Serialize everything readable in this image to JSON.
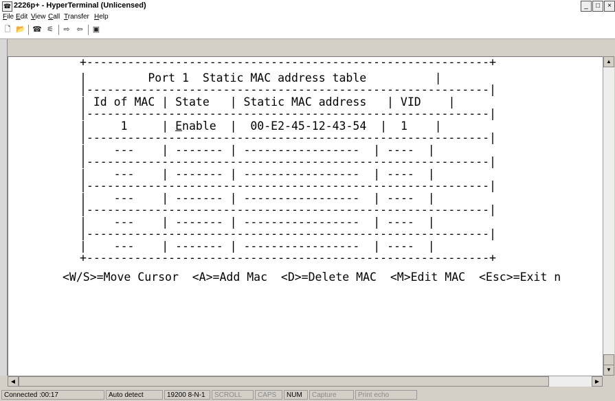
{
  "window": {
    "title": "2226p+ - HyperTerminal (Unlicensed)"
  },
  "menu": [
    {
      "mnemonic": "F",
      "rest": "ile"
    },
    {
      "mnemonic": "E",
      "rest": "dit"
    },
    {
      "mnemonic": "V",
      "rest": "iew"
    },
    {
      "mnemonic": "C",
      "rest": "all"
    },
    {
      "mnemonic": "T",
      "rest": "ransfer"
    },
    {
      "mnemonic": "H",
      "rest": "elp"
    }
  ],
  "toolbar": {
    "new_icon": "new-connection-icon",
    "open_icon": "open-folder-icon",
    "call_icon": "call-icon",
    "disconnect_icon": "disconnect-icon",
    "send_icon": "send-file-icon",
    "receive_icon": "receive-file-icon",
    "properties_icon": "properties-icon"
  },
  "terminal": {
    "table_title": "Port 1  Static MAC address table",
    "headers": [
      "Id of MAC",
      "State",
      "Static MAC address",
      "VID"
    ],
    "rows": [
      {
        "id": "1",
        "state_first": "E",
        "state_rest": "nable",
        "mac": "00-E2-45-12-43-54",
        "vid": "1"
      },
      {
        "id": "---",
        "state": "-------",
        "mac": "-----------------",
        "vid": "----"
      },
      {
        "id": "---",
        "state": "-------",
        "mac": "-----------------",
        "vid": "----"
      },
      {
        "id": "---",
        "state": "-------",
        "mac": "-----------------",
        "vid": "----"
      },
      {
        "id": "---",
        "state": "-------",
        "mac": "-----------------",
        "vid": "----"
      },
      {
        "id": "---",
        "state": "-------",
        "mac": "-----------------",
        "vid": "----"
      }
    ],
    "help_line": "<W/S>=Move Cursor  <A>=Add Mac  <D>=Delete MAC  <M>Edit MAC  <Esc>=Exit n"
  },
  "statusbar": {
    "connected": "Connected :00:17",
    "detect": "Auto detect",
    "settings": "19200 8-N-1",
    "scroll": "SCROLL",
    "caps": "CAPS",
    "num": "NUM",
    "capture": "Capture",
    "print_echo": "Print echo"
  }
}
